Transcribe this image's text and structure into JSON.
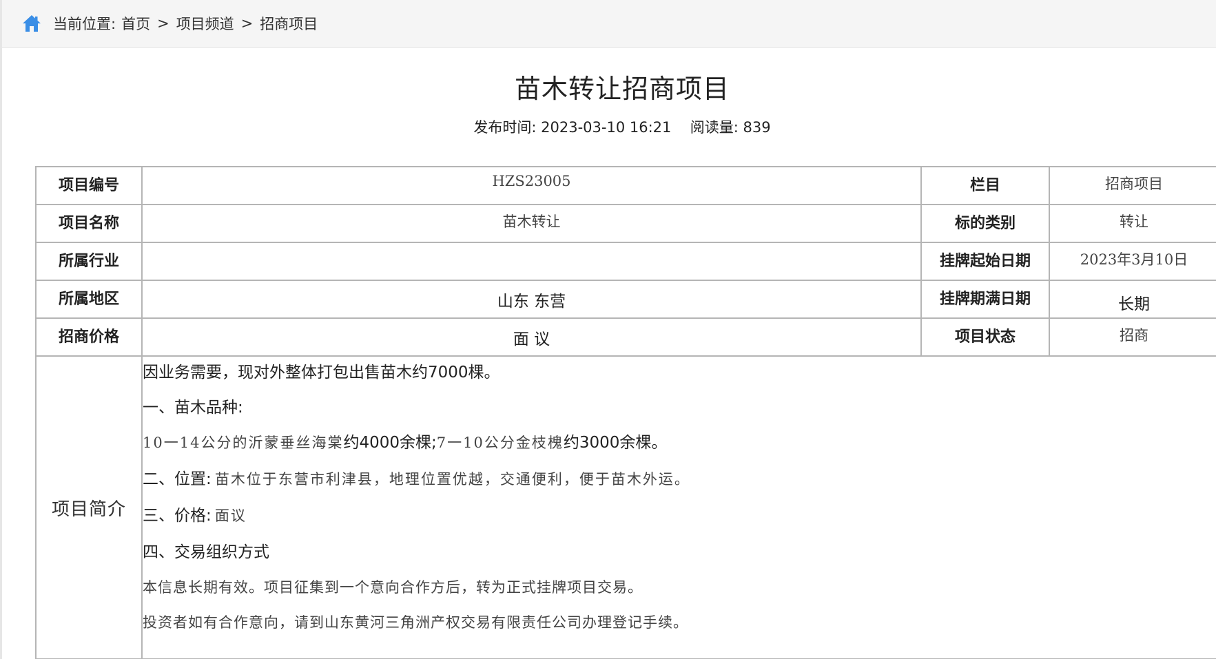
{
  "breadcrumb": {
    "prefix": "当前位置:",
    "items": [
      "首页",
      "项目频道",
      "招商项目"
    ],
    "separator": ">"
  },
  "article": {
    "title": "苗木转让招商项目",
    "publish_label": "发布时间:",
    "publish_time": "2023-03-10 16:21",
    "read_label": "阅读量:",
    "read_count": "839"
  },
  "info_table": {
    "project_no_label": "项目编号",
    "project_no": "HZS23005",
    "column_label": "栏目",
    "column": "招商项目",
    "project_name_label": "项目名称",
    "project_name": "苗木转让",
    "subject_type_label": "标的类别",
    "subject_type": "转让",
    "industry_label": "所属行业",
    "industry": "",
    "listing_start_label": "挂牌起始日期",
    "listing_start": "2023年3月10日",
    "region_label": "所属地区",
    "region": "山东 东营",
    "listing_end_label": "挂牌期满日期",
    "listing_end": "长期",
    "price_label": "招商价格",
    "price": "面 议",
    "status_label": "项目状态",
    "status": "招商",
    "intro_label": "项目简介"
  },
  "intro": {
    "p1": "因业务需要，现对外整体打包出售苗木约7000棵。",
    "p2": "一、苗木品种:",
    "p3_a": "10一14公分的沂蒙垂丝海棠",
    "p3_b": "约4000余棵;",
    "p3_c": "7一10公分金枝槐",
    "p3_d": "约3000余棵。",
    "p4_head": "二、位置:",
    "p4_text": "苗木位于东营市利津县，地理位置优越，交通便利，便于苗木外运。",
    "p5_head": "三、价格:",
    "p5_text": "面议",
    "p6": "四、交易组织方式",
    "p7": "本信息长期有效。项目征集到一个意向合作方后，转为正式挂牌项目交易。",
    "p8": "投资者如有合作意向，请到山东黄河三角洲产权交易有限责任公司办理登记手续。"
  },
  "colors": {
    "home_icon": "#3a8ee6",
    "topbar_bg": "#f5f5f5",
    "table_border": "#b5b5b5"
  }
}
